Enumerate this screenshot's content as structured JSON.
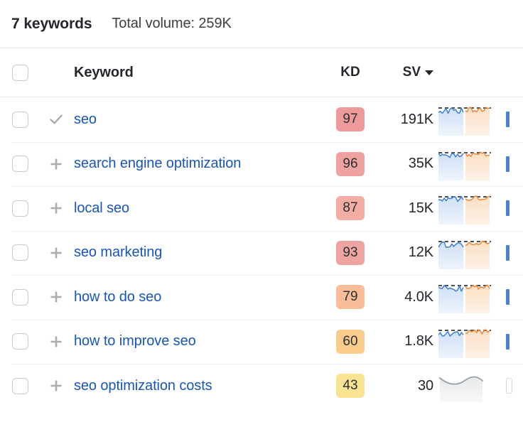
{
  "summary": {
    "count_label": "7 keywords",
    "volume_label": "Total volume: 259K"
  },
  "table": {
    "columns": {
      "keyword": "Keyword",
      "kd": "KD",
      "sv": "SV"
    },
    "sort": {
      "column": "SV",
      "direction": "descending",
      "icon": "caret-down-icon"
    },
    "select_all_checked": false,
    "rows": [
      {
        "checked": false,
        "action_icon": "check-icon",
        "keyword": "seo",
        "kd": "97",
        "kd_color": "#ef9a9a",
        "sv": "191K",
        "sparkline": "blue-orange",
        "tail": "bar"
      },
      {
        "checked": false,
        "action_icon": "plus-icon",
        "keyword": "search engine optimization",
        "kd": "96",
        "kd_color": "#efa3a0",
        "sv": "35K",
        "sparkline": "blue-orange",
        "tail": "bar"
      },
      {
        "checked": false,
        "action_icon": "plus-icon",
        "keyword": "local seo",
        "kd": "87",
        "kd_color": "#f4ada4",
        "sv": "15K",
        "sparkline": "blue-orange",
        "tail": "bar"
      },
      {
        "checked": false,
        "action_icon": "plus-icon",
        "keyword": "seo marketing",
        "kd": "93",
        "kd_color": "#efa4a2",
        "sv": "12K",
        "sparkline": "blue-orange",
        "tail": "bar"
      },
      {
        "checked": false,
        "action_icon": "plus-icon",
        "keyword": "how to do seo",
        "kd": "79",
        "kd_color": "#f9bd97",
        "sv": "4.0K",
        "sparkline": "blue-orange",
        "tail": "bar"
      },
      {
        "checked": false,
        "action_icon": "plus-icon",
        "keyword": "how to improve seo",
        "kd": "60",
        "kd_color": "#f9cc8b",
        "sv": "1.8K",
        "sparkline": "blue-orange",
        "tail": "bar"
      },
      {
        "checked": false,
        "action_icon": "plus-icon",
        "keyword": "seo optimization costs",
        "kd": "43",
        "kd_color": "#fae493",
        "sv": "30",
        "sparkline": "gray-curve",
        "tail": "box"
      }
    ]
  },
  "colors": {
    "link": "#1a56b0",
    "text": "#23262b",
    "divider": "#eceef0",
    "spark_blue": "#3f7fd0",
    "spark_orange": "#e8873a",
    "spark_gray": "#9aa0a6"
  }
}
